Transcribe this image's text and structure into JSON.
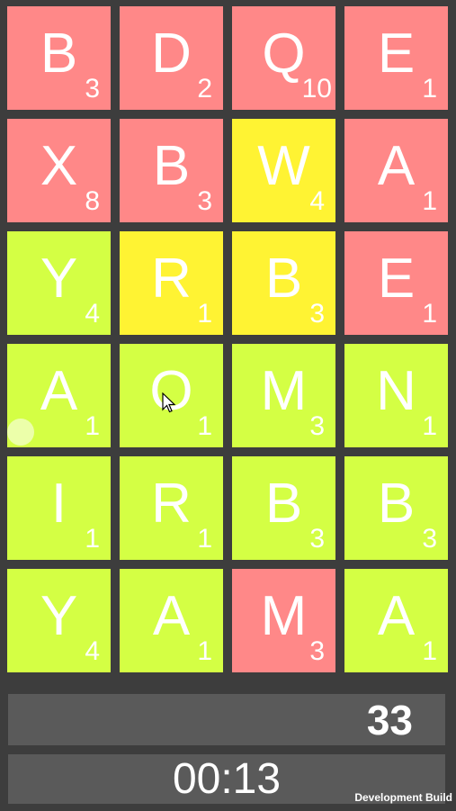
{
  "tile_colors": {
    "used": "#ff8888",
    "selected": "#fff333",
    "available": "#d4ff44"
  },
  "board": [
    [
      {
        "letter": "B",
        "points": "3",
        "state": "used"
      },
      {
        "letter": "D",
        "points": "2",
        "state": "used"
      },
      {
        "letter": "Q",
        "points": "10",
        "state": "used"
      },
      {
        "letter": "E",
        "points": "1",
        "state": "used"
      }
    ],
    [
      {
        "letter": "X",
        "points": "8",
        "state": "used"
      },
      {
        "letter": "B",
        "points": "3",
        "state": "used"
      },
      {
        "letter": "W",
        "points": "4",
        "state": "selected"
      },
      {
        "letter": "A",
        "points": "1",
        "state": "used"
      }
    ],
    [
      {
        "letter": "Y",
        "points": "4",
        "state": "available"
      },
      {
        "letter": "R",
        "points": "1",
        "state": "selected"
      },
      {
        "letter": "B",
        "points": "3",
        "state": "selected"
      },
      {
        "letter": "E",
        "points": "1",
        "state": "used"
      }
    ],
    [
      {
        "letter": "A",
        "points": "1",
        "state": "available"
      },
      {
        "letter": "O",
        "points": "1",
        "state": "available"
      },
      {
        "letter": "M",
        "points": "3",
        "state": "available"
      },
      {
        "letter": "N",
        "points": "1",
        "state": "available"
      }
    ],
    [
      {
        "letter": "I",
        "points": "1",
        "state": "available"
      },
      {
        "letter": "R",
        "points": "1",
        "state": "available"
      },
      {
        "letter": "B",
        "points": "3",
        "state": "available"
      },
      {
        "letter": "B",
        "points": "3",
        "state": "available"
      }
    ],
    [
      {
        "letter": "Y",
        "points": "4",
        "state": "available"
      },
      {
        "letter": "A",
        "points": "1",
        "state": "available"
      },
      {
        "letter": "M",
        "points": "3",
        "state": "used"
      },
      {
        "letter": "A",
        "points": "1",
        "state": "available"
      }
    ]
  ],
  "score": "33",
  "timer": "00:13",
  "footer": {
    "dev_build_label": "Development Build"
  },
  "cursor_icon": "arrow-cursor-icon",
  "touch_indicator_icon": "touch-dot-icon"
}
